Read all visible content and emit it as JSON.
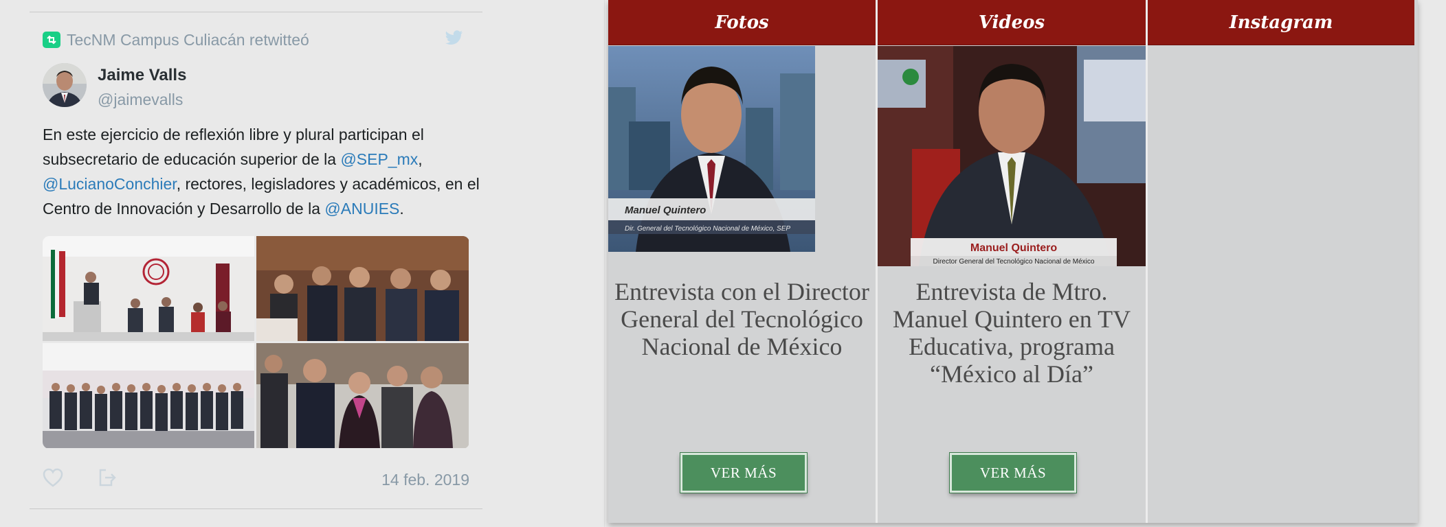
{
  "tweet": {
    "retweet_line": "TecNM Campus Culiacán retwitteó",
    "author_name": "Jaime Valls",
    "author_handle": "@jaimevalls",
    "text_parts": [
      {
        "text": "En este ejercicio de reflexión libre y plural participan el subsecretario de educación superior de la ",
        "mention": false
      },
      {
        "text": "@SEP_mx",
        "mention": true
      },
      {
        "text": ", ",
        "mention": false
      },
      {
        "text": "@LucianoConchier",
        "mention": true
      },
      {
        "text": ", rectores, legisladores y académicos, en el Centro de Innovación y Desarrollo de la ",
        "mention": false
      },
      {
        "text": "@ANUIES",
        "mention": true
      },
      {
        "text": ".",
        "mention": false
      }
    ],
    "date": "14 feb. 2019",
    "colors": {
      "mention": "#2b7bb9",
      "muted": "#8899a6",
      "retweet_green": "#19cf86"
    }
  },
  "media": {
    "columns": [
      {
        "header": "Fotos",
        "title": "Entrevista con el Director General del Tecnológico Nacional de México",
        "button": "VER MÁS"
      },
      {
        "header": "Videos",
        "title": "Entrevista de Mtro. Manuel Quintero en TV Educativa, programa “México al Día”",
        "button": "VER MÁS"
      },
      {
        "header": "Instagram"
      }
    ],
    "thumb_captions": {
      "fotos_name": "Manuel Quintero",
      "fotos_sub": "Dir. General del Tecnológico Nacional de México, SEP",
      "videos_name": "Manuel Quintero",
      "videos_sub": "Director General del Tecnológico Nacional de México"
    },
    "colors": {
      "header_bg": "#8b1711",
      "button_bg": "#4c8f5d",
      "panel_bg": "#d2d3d4"
    }
  }
}
